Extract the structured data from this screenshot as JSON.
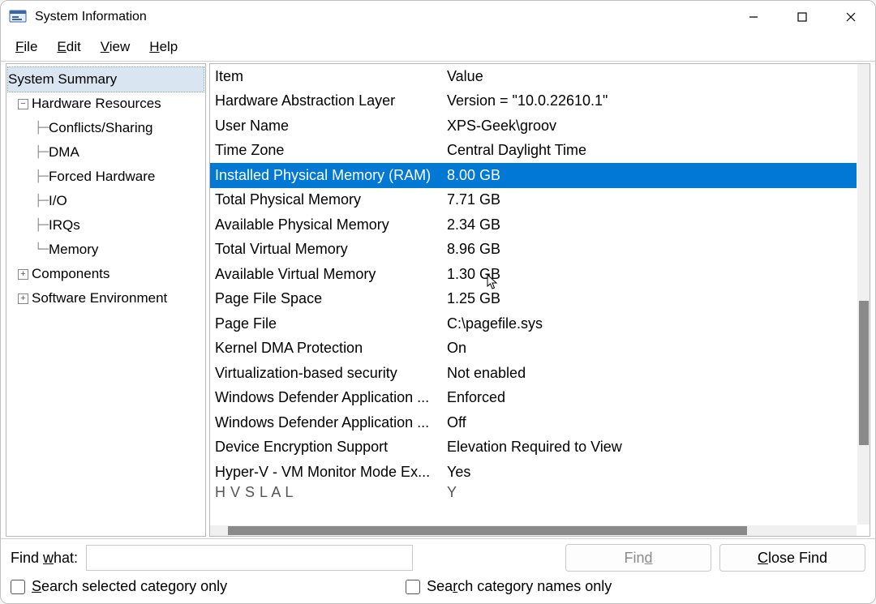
{
  "title": "System Information",
  "menu": {
    "file": "File",
    "edit": "Edit",
    "view": "View",
    "help": "Help"
  },
  "tree": {
    "root": "System Summary",
    "hw": "Hardware Resources",
    "hw_children": [
      "Conflicts/Sharing",
      "DMA",
      "Forced Hardware",
      "I/O",
      "IRQs",
      "Memory"
    ],
    "components": "Components",
    "swenv": "Software Environment"
  },
  "list": {
    "header_item": "Item",
    "header_value": "Value",
    "selected_index": 3,
    "rows": [
      {
        "item": "Hardware Abstraction Layer",
        "value": "Version = \"10.0.22610.1\""
      },
      {
        "item": "User Name",
        "value": "XPS-Geek\\groov"
      },
      {
        "item": "Time Zone",
        "value": "Central Daylight Time"
      },
      {
        "item": "Installed Physical Memory (RAM)",
        "value": "8.00 GB"
      },
      {
        "item": "Total Physical Memory",
        "value": "7.71 GB"
      },
      {
        "item": "Available Physical Memory",
        "value": "2.34 GB"
      },
      {
        "item": "Total Virtual Memory",
        "value": "8.96 GB"
      },
      {
        "item": "Available Virtual Memory",
        "value": "1.30 GB"
      },
      {
        "item": "Page File Space",
        "value": "1.25 GB"
      },
      {
        "item": "Page File",
        "value": "C:\\pagefile.sys"
      },
      {
        "item": "Kernel DMA Protection",
        "value": "On"
      },
      {
        "item": "Virtualization-based security",
        "value": "Not enabled"
      },
      {
        "item": "Windows Defender Application ...",
        "value": "Enforced"
      },
      {
        "item": "Windows Defender Application ...",
        "value": "Off"
      },
      {
        "item": "Device Encryption Support",
        "value": "Elevation Required to View"
      },
      {
        "item": "Hyper-V - VM Monitor Mode Ex...",
        "value": "Yes"
      }
    ],
    "partial_item": "H      V   S        L       A   L",
    "partial_value": "Y"
  },
  "search": {
    "label_html": "Find what:",
    "value": "",
    "find": "Find",
    "close_find": "Close Find",
    "chk1": "Search selected category only",
    "chk2": "Search category names only"
  }
}
